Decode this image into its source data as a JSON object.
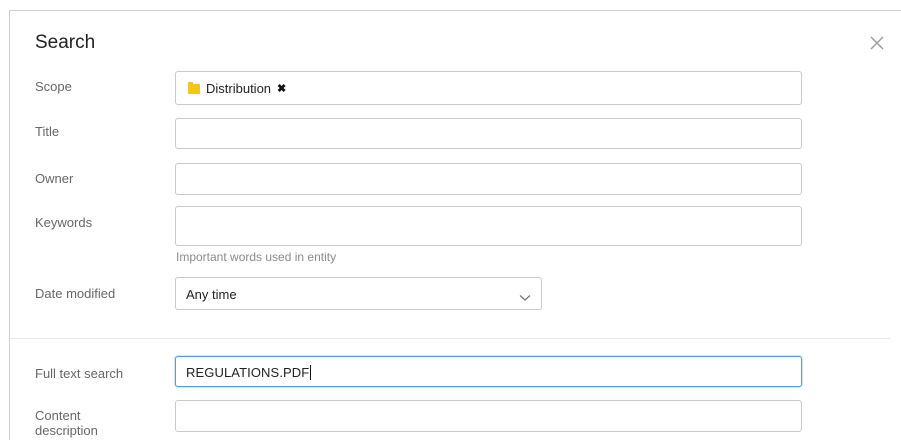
{
  "dialog": {
    "title": "Search",
    "close_icon": "close-icon"
  },
  "form": {
    "scope": {
      "label": "Scope",
      "chips": [
        {
          "label": "Distribution",
          "icon": "folder-icon",
          "remove_icon": "remove-chip-icon"
        }
      ]
    },
    "title": {
      "label": "Title",
      "value": ""
    },
    "owner": {
      "label": "Owner",
      "value": ""
    },
    "keywords": {
      "label": "Keywords",
      "value": "",
      "hint": "Important words used in entity"
    },
    "date_modified": {
      "label": "Date modified",
      "value": "Any time",
      "icon": "chevron-down-icon"
    },
    "full_text": {
      "label": "Full text search",
      "value": "REGULATIONS.PDF"
    },
    "content_description": {
      "label": "Content description",
      "value": ""
    }
  },
  "colors": {
    "folder": "#f5c518",
    "focus_border": "#4aa3d6",
    "input_border": "#c9c9c9",
    "label": "#666666",
    "hint": "#8a8a8a"
  }
}
